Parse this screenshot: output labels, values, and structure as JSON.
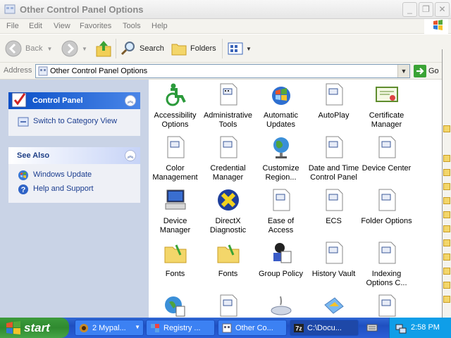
{
  "window": {
    "title": "Other Control Panel Options"
  },
  "menu": [
    "File",
    "Edit",
    "View",
    "Favorites",
    "Tools",
    "Help"
  ],
  "toolbar": {
    "back_label": "Back",
    "search_label": "Search",
    "folders_label": "Folders"
  },
  "address": {
    "label": "Address",
    "value": "Other Control Panel Options",
    "go_label": "Go"
  },
  "leftpane": {
    "control_panel": {
      "title": "Control Panel",
      "items": [
        {
          "label": "Switch to Category View",
          "icon": "category-view-icon"
        }
      ]
    },
    "see_also": {
      "title": "See Also",
      "items": [
        {
          "label": "Windows Update",
          "icon": "windows-update-icon"
        },
        {
          "label": "Help and Support",
          "icon": "help-icon"
        }
      ]
    }
  },
  "icons": [
    {
      "label": "Accessibility Options",
      "icon": "accessibility-icon"
    },
    {
      "label": "Administrative Tools",
      "icon": "admin-tools-icon"
    },
    {
      "label": "Automatic Updates",
      "icon": "automatic-updates-icon"
    },
    {
      "label": "AutoPlay",
      "icon": "autoplay-icon"
    },
    {
      "label": "Certificate Manager",
      "icon": "certificate-icon"
    },
    {
      "label": "Color Management",
      "icon": "color-management-icon"
    },
    {
      "label": "Credential Manager",
      "icon": "credential-manager-icon"
    },
    {
      "label": "Customize Region...",
      "icon": "globe-icon"
    },
    {
      "label": "Date and Time Control Panel",
      "icon": "date-time-icon"
    },
    {
      "label": "Device Center",
      "icon": "device-center-icon"
    },
    {
      "label": "Device Manager",
      "icon": "device-manager-icon"
    },
    {
      "label": "DirectX Diagnostic",
      "icon": "directx-icon"
    },
    {
      "label": "Ease of Access",
      "icon": "ease-of-access-icon"
    },
    {
      "label": "ECS",
      "icon": "ecs-icon"
    },
    {
      "label": "Folder Options",
      "icon": "folder-options-icon"
    },
    {
      "label": "Fonts",
      "icon": "fonts-folder-icon"
    },
    {
      "label": "Fonts",
      "icon": "fonts-folder-icon"
    },
    {
      "label": "Group Policy",
      "icon": "group-policy-icon"
    },
    {
      "label": "History Vault",
      "icon": "history-vault-icon"
    },
    {
      "label": "Indexing Options C...",
      "icon": "indexing-icon"
    },
    {
      "label": "",
      "icon": "network-icon"
    },
    {
      "label": "",
      "icon": "applet-icon"
    },
    {
      "label": "",
      "icon": "keyboard-icon"
    },
    {
      "label": "",
      "icon": "display-icon"
    },
    {
      "label": "",
      "icon": "applet-icon"
    }
  ],
  "taskbar": {
    "start_label": "start",
    "buttons": [
      {
        "label": "2 Mypal...",
        "icon": "mypal-icon",
        "count": "2"
      },
      {
        "label": "Registry ...",
        "icon": "registry-icon"
      },
      {
        "label": "Other Co...",
        "icon": "control-panel-icon"
      },
      {
        "label": "C:\\Docu...",
        "icon": "7zip-icon"
      }
    ],
    "clock": "2:58 PM"
  },
  "colors": {
    "taskbar": "#245edb",
    "start": "#3c9b3c",
    "pane": "#c9d3e6",
    "link": "#1b3d8f"
  }
}
